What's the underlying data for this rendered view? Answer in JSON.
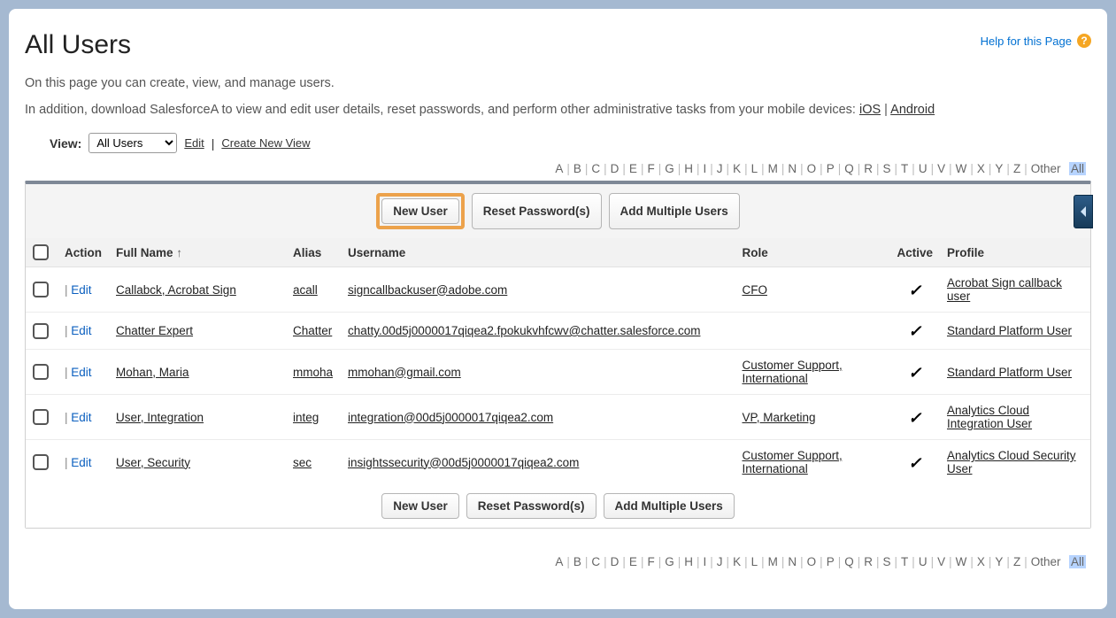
{
  "header": {
    "title": "All Users",
    "help_label": "Help for this Page"
  },
  "intro": {
    "line1": "On this page you can create, view, and manage users.",
    "line2_pre": "In addition, download SalesforceA to view and edit user details, reset passwords, and perform other administrative tasks from your mobile devices: ",
    "ios_label": "iOS",
    "android_label": "Android"
  },
  "view": {
    "label": "View:",
    "selected": "All Users",
    "edit_label": "Edit",
    "create_label": "Create New View"
  },
  "alpha": {
    "letters": [
      "A",
      "B",
      "C",
      "D",
      "E",
      "F",
      "G",
      "H",
      "I",
      "J",
      "K",
      "L",
      "M",
      "N",
      "O",
      "P",
      "Q",
      "R",
      "S",
      "T",
      "U",
      "V",
      "W",
      "X",
      "Y",
      "Z"
    ],
    "other_label": "Other",
    "all_label": "All"
  },
  "buttons": {
    "new_user": "New User",
    "reset_pw": "Reset Password(s)",
    "add_multiple": "Add Multiple Users"
  },
  "columns": {
    "action": "Action",
    "full_name": "Full Name",
    "alias": "Alias",
    "username": "Username",
    "role": "Role",
    "active": "Active",
    "profile": "Profile"
  },
  "action_label": "Edit",
  "rows": [
    {
      "full_name": "Callabck, Acrobat Sign",
      "alias": "acall",
      "username": "signcallbackuser@adobe.com",
      "role": "CFO",
      "active": true,
      "profile": "Acrobat Sign callback user"
    },
    {
      "full_name": "Chatter Expert",
      "alias": "Chatter",
      "username": "chatty.00d5j0000017qiqea2.fpokukvhfcwv@chatter.salesforce.com",
      "role": "",
      "active": true,
      "profile": "Standard Platform User"
    },
    {
      "full_name": "Mohan, Maria",
      "alias": "mmoha",
      "username": "mmohan@gmail.com",
      "role": "Customer Support, International",
      "active": true,
      "profile": "Standard Platform User"
    },
    {
      "full_name": "User, Integration",
      "alias": "integ",
      "username": "integration@00d5j0000017qiqea2.com",
      "role": "VP, Marketing",
      "active": true,
      "profile": "Analytics Cloud Integration User"
    },
    {
      "full_name": "User, Security",
      "alias": "sec",
      "username": "insightssecurity@00d5j0000017qiqea2.com",
      "role": "Customer Support, International",
      "active": true,
      "profile": "Analytics Cloud Security User"
    }
  ]
}
